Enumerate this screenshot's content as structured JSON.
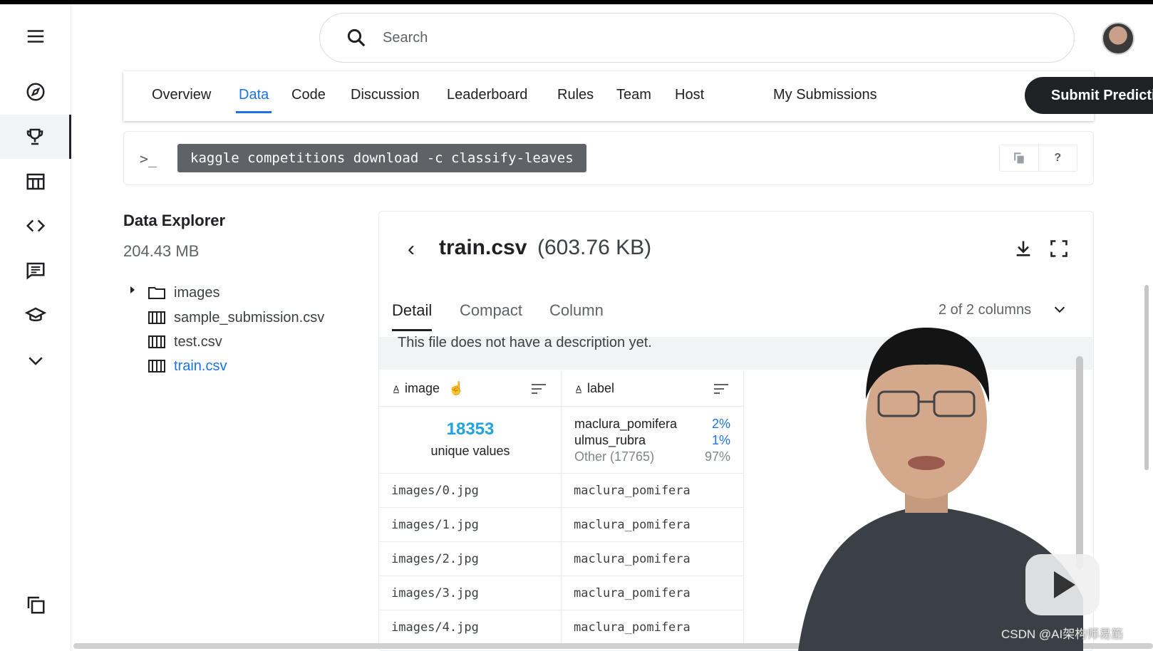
{
  "search": {
    "placeholder": "Search"
  },
  "tabs": {
    "overview": "Overview",
    "data": "Data",
    "code": "Code",
    "discussion": "Discussion",
    "leaderboard": "Leaderboard",
    "rules": "Rules",
    "team": "Team",
    "host": "Host",
    "my_submissions": "My Submissions",
    "submit": "Submit Predictions"
  },
  "api": {
    "prompt": ">_",
    "command": "kaggle competitions download -c classify-leaves",
    "help": "?"
  },
  "explorer": {
    "title": "Data Explorer",
    "size": "204.43 MB",
    "items": [
      {
        "label": "images",
        "icon": "folder-icon"
      },
      {
        "label": "sample_submission.csv",
        "icon": "table-icon"
      },
      {
        "label": "test.csv",
        "icon": "table-icon"
      },
      {
        "label": "train.csv",
        "icon": "table-icon",
        "selected": true
      }
    ]
  },
  "file": {
    "name": "train.csv",
    "size": "(603.76 KB)",
    "view_tabs": [
      "Detail",
      "Compact",
      "Column"
    ],
    "columns_selector": "2 of 2 columns",
    "description": "This file does not have a description yet.",
    "columns": [
      {
        "name": "image",
        "type_icon": "A"
      },
      {
        "name": "label",
        "type_icon": "A"
      }
    ],
    "image_stats": {
      "unique_count": "18353",
      "unique_label": "unique values"
    },
    "label_stats": [
      {
        "value": "maclura_pomifera",
        "pct": "2%"
      },
      {
        "value": "ulmus_rubra",
        "pct": "1%"
      },
      {
        "value": "Other (17765)",
        "pct": "97%"
      }
    ],
    "rows": [
      [
        "images/0.jpg",
        "maclura_pomifera"
      ],
      [
        "images/1.jpg",
        "maclura_pomifera"
      ],
      [
        "images/2.jpg",
        "maclura_pomifera"
      ],
      [
        "images/3.jpg",
        "maclura_pomifera"
      ],
      [
        "images/4.jpg",
        "maclura_pomifera"
      ]
    ]
  },
  "watermark": "CSDN @AI架构师易筋",
  "colors": {
    "accent": "#1a73e8",
    "dark": "#202124",
    "unique": "#20a4db"
  }
}
